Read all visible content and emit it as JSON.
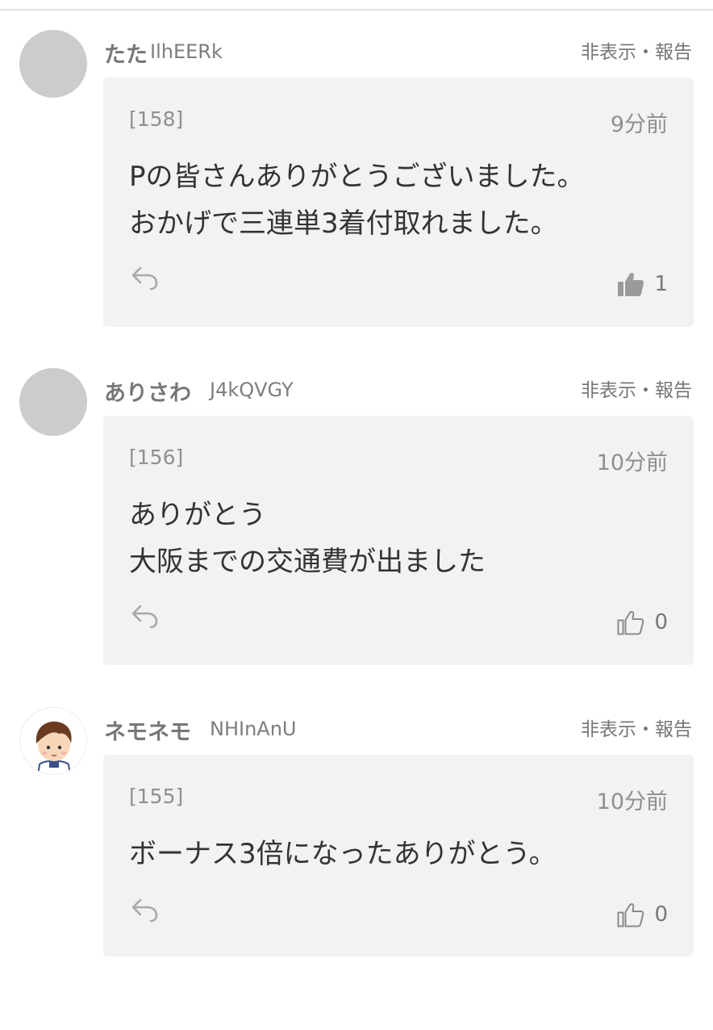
{
  "comments": [
    {
      "username": "たた",
      "user_id": "IlhEERk",
      "actions": "非表示・報告",
      "number": "[158]",
      "time": "9分前",
      "lines": [
        "Pの皆さんありがとうございました。",
        "おかげで三連単3着付取れました。"
      ],
      "likes": "1",
      "liked": true,
      "avatar": "placeholder"
    },
    {
      "username": "ありさわ",
      "user_id": "J4kQVGY",
      "actions": "非表示・報告",
      "number": "[156]",
      "time": "10分前",
      "lines": [
        "ありがとう",
        "大阪までの交通費が出ました"
      ],
      "likes": "0",
      "liked": false,
      "avatar": "placeholder"
    },
    {
      "username": "ネモネモ",
      "user_id": "NHInAnU",
      "actions": "非表示・報告",
      "number": "[155]",
      "time": "10分前",
      "lines": [
        "ボーナス3倍になったありがとう。"
      ],
      "likes": "0",
      "liked": false,
      "avatar": "boy-character"
    }
  ],
  "icons": {
    "reply": "reply-arrow-icon",
    "like_filled": "thumbs-up-filled-icon",
    "like_outline": "thumbs-up-outline-icon"
  },
  "colors": {
    "box_bg": "#f2f2f2",
    "text": "#333333",
    "muted": "#8f8f8f",
    "avatar_placeholder": "#cccccc"
  }
}
